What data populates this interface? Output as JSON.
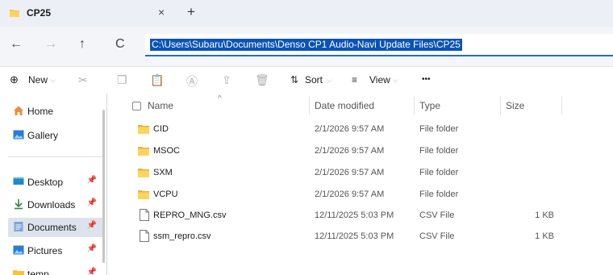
{
  "tab": {
    "title": "CP25",
    "close": "×",
    "new": "+"
  },
  "nav": {
    "back": "←",
    "forward": "→",
    "up": "↑",
    "refresh": "C"
  },
  "address": {
    "path": "C:\\Users\\Subaru\\Documents\\Denso CP1 Audio-Navi Update Files\\CP25"
  },
  "toolbar": {
    "new_label": "New",
    "sort_label": "Sort",
    "view_label": "View",
    "more_label": "•••"
  },
  "sidebar": {
    "items": [
      {
        "label": "Home"
      },
      {
        "label": "Gallery"
      },
      {
        "label": "Desktop"
      },
      {
        "label": "Downloads"
      },
      {
        "label": "Documents"
      },
      {
        "label": "Pictures"
      },
      {
        "label": "temp"
      }
    ]
  },
  "columns": {
    "name": "Name",
    "date": "Date modified",
    "type": "Type",
    "size": "Size"
  },
  "files": [
    {
      "name": "CID",
      "date": "2/1/2026 9:57 AM",
      "type": "File folder",
      "size": ""
    },
    {
      "name": "MSOC",
      "date": "2/1/2026 9:57 AM",
      "type": "File folder",
      "size": ""
    },
    {
      "name": "SXM",
      "date": "2/1/2026 9:57 AM",
      "type": "File folder",
      "size": ""
    },
    {
      "name": "VCPU",
      "date": "2/1/2026 9:57 AM",
      "type": "File folder",
      "size": ""
    },
    {
      "name": "REPRO_MNG.csv",
      "date": "12/11/2025 5:03 PM",
      "type": "CSV File",
      "size": "1 KB"
    },
    {
      "name": "ssm_repro.csv",
      "date": "12/11/2025 5:03 PM",
      "type": "CSV File",
      "size": "1 KB"
    }
  ]
}
